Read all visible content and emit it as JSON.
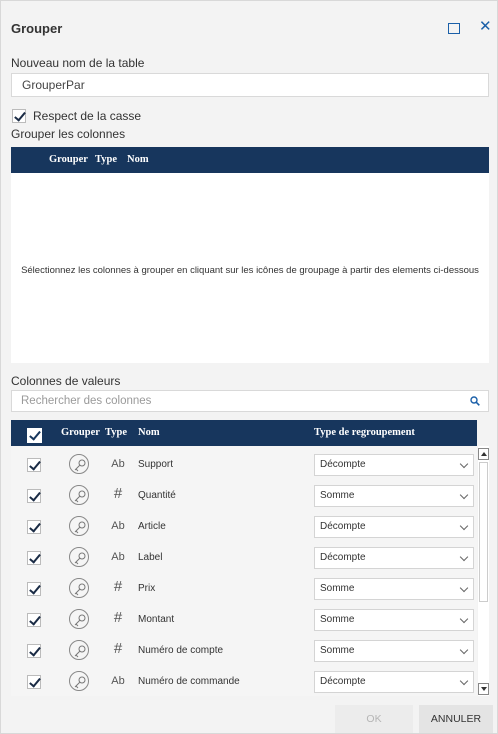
{
  "window": {
    "title": "Grouper"
  },
  "form": {
    "table_name_label": "Nouveau nom de la table",
    "table_name_value": "GrouperPar",
    "case_sensitive_label": "Respect de la casse",
    "case_sensitive_checked": true,
    "group_columns_label": "Grouper les colonnes"
  },
  "group_table": {
    "headers": {
      "grouper": "Grouper",
      "type": "Type",
      "name": "Nom"
    },
    "empty_message": "Sélectionnez les colonnes à grouper en cliquant sur les icônes de groupage à partir des elements ci-dessous"
  },
  "values_section": {
    "label": "Colonnes de valeurs",
    "search_placeholder": "Rechercher des colonnes",
    "headers": {
      "grouper": "Grouper",
      "type": "Type",
      "name": "Nom",
      "agg": "Type de regroupement"
    },
    "rows": [
      {
        "checked": true,
        "type": "Ab",
        "name": "Support",
        "agg": "Décompte"
      },
      {
        "checked": true,
        "type": "#",
        "name": "Quantité",
        "agg": "Somme"
      },
      {
        "checked": true,
        "type": "Ab",
        "name": "Article",
        "agg": "Décompte"
      },
      {
        "checked": true,
        "type": "Ab",
        "name": "Label",
        "agg": "Décompte"
      },
      {
        "checked": true,
        "type": "#",
        "name": "Prix",
        "agg": "Somme"
      },
      {
        "checked": true,
        "type": "#",
        "name": "Montant",
        "agg": "Somme"
      },
      {
        "checked": true,
        "type": "#",
        "name": "Numéro de compte",
        "agg": "Somme"
      },
      {
        "checked": true,
        "type": "Ab",
        "name": "Numéro de commande",
        "agg": "Décompte"
      }
    ]
  },
  "footer": {
    "ok_label": "OK",
    "cancel_label": "ANNULER"
  },
  "colors": {
    "header_bg": "#17365d",
    "accent": "#1a5fa8",
    "dialog_bg": "#f3f3f3"
  },
  "icons": [
    "maximize-icon",
    "close-icon",
    "check-icon",
    "search-icon",
    "group-key-icon",
    "chevron-down-icon",
    "scroll-up-icon",
    "scroll-down-icon"
  ]
}
